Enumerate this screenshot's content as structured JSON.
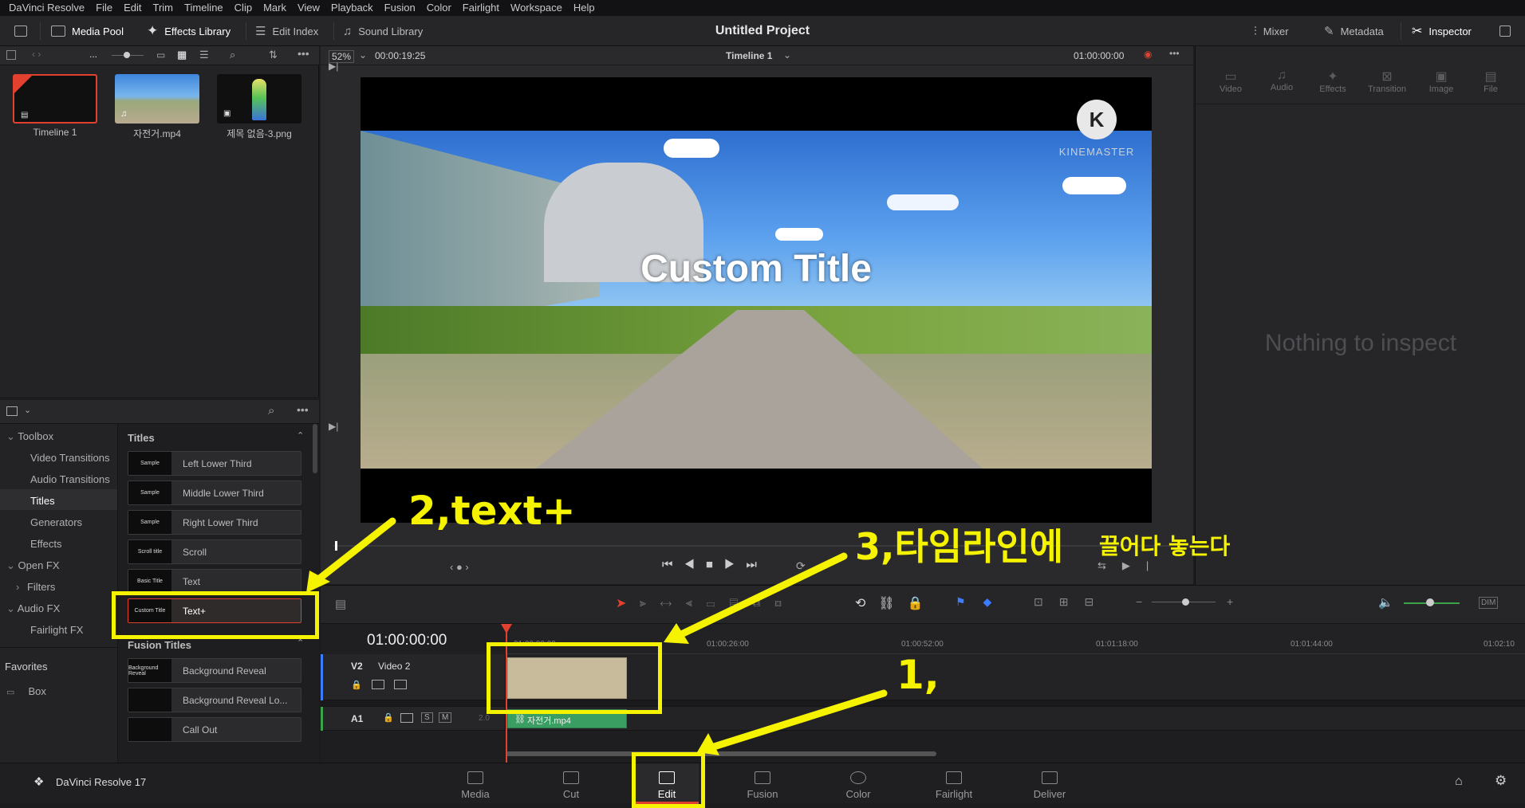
{
  "menubar": [
    "DaVinci Resolve",
    "File",
    "Edit",
    "Trim",
    "Timeline",
    "Clip",
    "Mark",
    "View",
    "Playback",
    "Fusion",
    "Color",
    "Fairlight",
    "Workspace",
    "Help"
  ],
  "toolbar": {
    "media_pool": "Media Pool",
    "effects_library": "Effects Library",
    "edit_index": "Edit Index",
    "sound_library": "Sound Library",
    "project_title": "Untitled Project",
    "mixer": "Mixer",
    "metadata": "Metadata",
    "inspector": "Inspector"
  },
  "viewer_bar": {
    "zoom": "52%",
    "duration": "00:00:19:25",
    "timeline_name": "Timeline 1",
    "timecode": "01:00:00:00"
  },
  "media_pool": {
    "more": "...",
    "clips": [
      {
        "name": "Timeline 1"
      },
      {
        "name": "자전거.mp4"
      },
      {
        "name": "제목 없음-3.png"
      }
    ]
  },
  "effects": {
    "tree": [
      {
        "label": "Toolbox"
      },
      {
        "label": "Video Transitions"
      },
      {
        "label": "Audio Transitions"
      },
      {
        "label": "Titles"
      },
      {
        "label": "Generators"
      },
      {
        "label": "Effects"
      },
      {
        "label": "Open FX"
      },
      {
        "label": "Filters"
      },
      {
        "label": "Audio FX"
      },
      {
        "label": "Fairlight FX"
      }
    ],
    "favorites_label": "Favorites",
    "favorites_item": "Box",
    "titles_header": "Titles",
    "titles": [
      {
        "label": "Left Lower Third",
        "thumb": "Sample"
      },
      {
        "label": "Middle Lower Third",
        "thumb": "Sample"
      },
      {
        "label": "Right Lower Third",
        "thumb": "Sample"
      },
      {
        "label": "Scroll",
        "thumb": "Scroll title"
      },
      {
        "label": "Text",
        "thumb": "Basic Title"
      },
      {
        "label": "Text+",
        "thumb": "Custom Title"
      }
    ],
    "fusion_header": "Fusion Titles",
    "fusion_titles": [
      {
        "label": "Background Reveal",
        "thumb": "Background Reveal"
      },
      {
        "label": "Background Reveal Lo...",
        "thumb": ""
      },
      {
        "label": "Call Out",
        "thumb": ""
      }
    ]
  },
  "viewer": {
    "overlay_title": "Custom Title",
    "watermark": "KINEMASTER"
  },
  "inspector": {
    "tabs": [
      "Video",
      "Audio",
      "Effects",
      "Transition",
      "Image",
      "File"
    ],
    "empty": "Nothing to inspect"
  },
  "timeline": {
    "timecode": "01:00:00:00",
    "ticks": [
      "01:00:00:00",
      "01:00:26:00",
      "01:00:52:00",
      "01:01:18:00",
      "01:01:44:00",
      "01:02:10"
    ],
    "v2_id": "V2",
    "v2_name": "Video 2",
    "a1_id": "A1",
    "a1_level": "2.0",
    "a1_clip": "자전거.mp4",
    "dim": "DIM",
    "s": "S",
    "m": "M"
  },
  "pages": {
    "app_name": "DaVinci Resolve 17",
    "items": [
      "Media",
      "Cut",
      "Edit",
      "Fusion",
      "Color",
      "Fairlight",
      "Deliver"
    ],
    "active": "Edit"
  },
  "annotations": {
    "step1": "1,",
    "step2": "2,text+",
    "step3_main": "3,타임라인에",
    "step3_sub": "끌어다 놓는다"
  },
  "colors": {
    "accent_red": "#e2412f",
    "highlight_yellow": "#f5f300",
    "clip_tan": "#c8bb9b",
    "audio_green": "#3a9d62"
  }
}
